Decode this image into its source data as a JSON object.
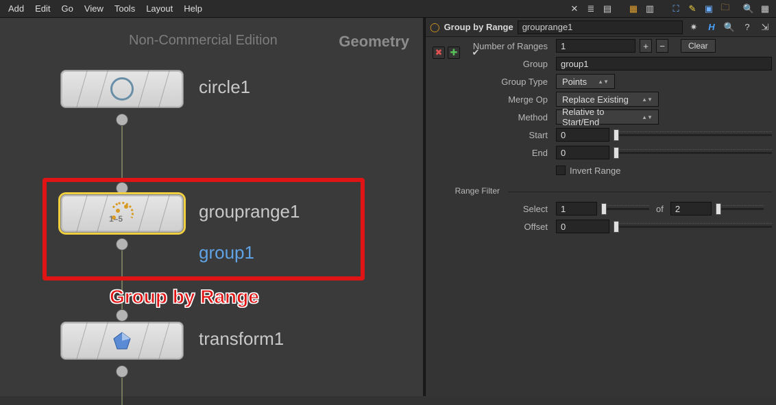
{
  "menubar": {
    "items": [
      "Add",
      "Edit",
      "Go",
      "View",
      "Tools",
      "Layout",
      "Help"
    ],
    "tool_icons": [
      "wrench-x-icon",
      "tree-icon",
      "list-icon",
      "palette-icon",
      "grid-icon",
      "expand-icon",
      "note-icon",
      "image-icon",
      "folder-icon",
      "search-icon",
      "gallery-icon"
    ]
  },
  "network": {
    "watermark": "Non-Commercial Edition",
    "context": "Geometry",
    "nodes": {
      "circle": {
        "label": "circle1"
      },
      "grouprange": {
        "label": "grouprange1",
        "group_out": "group1"
      },
      "transform": {
        "label": "transform1"
      }
    },
    "highlight_caption": "Group by Range"
  },
  "parm_header": {
    "node_type": "Group by Range",
    "node_path": "grouprange1",
    "icons": [
      "gear-icon",
      "help-h-icon",
      "search-icon",
      "info-icon",
      "pin-icon"
    ]
  },
  "parms": {
    "num_ranges_label": "Number of Ranges",
    "num_ranges_value": "1",
    "clear_label": "Clear",
    "group_label": "Group",
    "group_value": "group1",
    "group_type_label": "Group Type",
    "group_type_value": "Points",
    "merge_label": "Merge Op",
    "merge_value": "Replace Existing",
    "method_label": "Method",
    "method_value": "Relative to Start/End",
    "start_label": "Start",
    "start_value": "0",
    "end_label": "End",
    "end_value": "0",
    "invert_label": "Invert Range",
    "range_filter_label": "Range Filter",
    "select_label": "Select",
    "select_a": "1",
    "of_label": "of",
    "select_b": "2",
    "offset_label": "Offset",
    "offset_value": "0"
  }
}
